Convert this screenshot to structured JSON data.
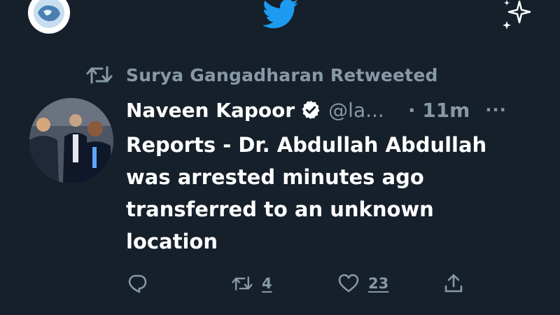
{
  "retweet_banner": {
    "text": "Surya Gangadharan Retweeted"
  },
  "tweet": {
    "author_name": "Naveen Kapoor",
    "handle": "@la...",
    "time": "· 11m",
    "more": "···",
    "body_lines": [
      "Reports - Dr. Abdullah Abdullah",
      "was arrested minutes ago",
      "transferred to an unknown",
      "location"
    ],
    "counts": {
      "retweets": "4",
      "likes": "23"
    }
  },
  "colors": {
    "background": "#15202b",
    "accent": "#1d9bf0",
    "muted_text": "#8899a6",
    "primary_text": "#ffffff"
  },
  "icons": [
    "profile-avatar",
    "twitter-bird-icon",
    "sparkle-icon",
    "retweet-icon",
    "verified-badge-icon",
    "reply-icon",
    "heart-icon",
    "share-icon"
  ]
}
